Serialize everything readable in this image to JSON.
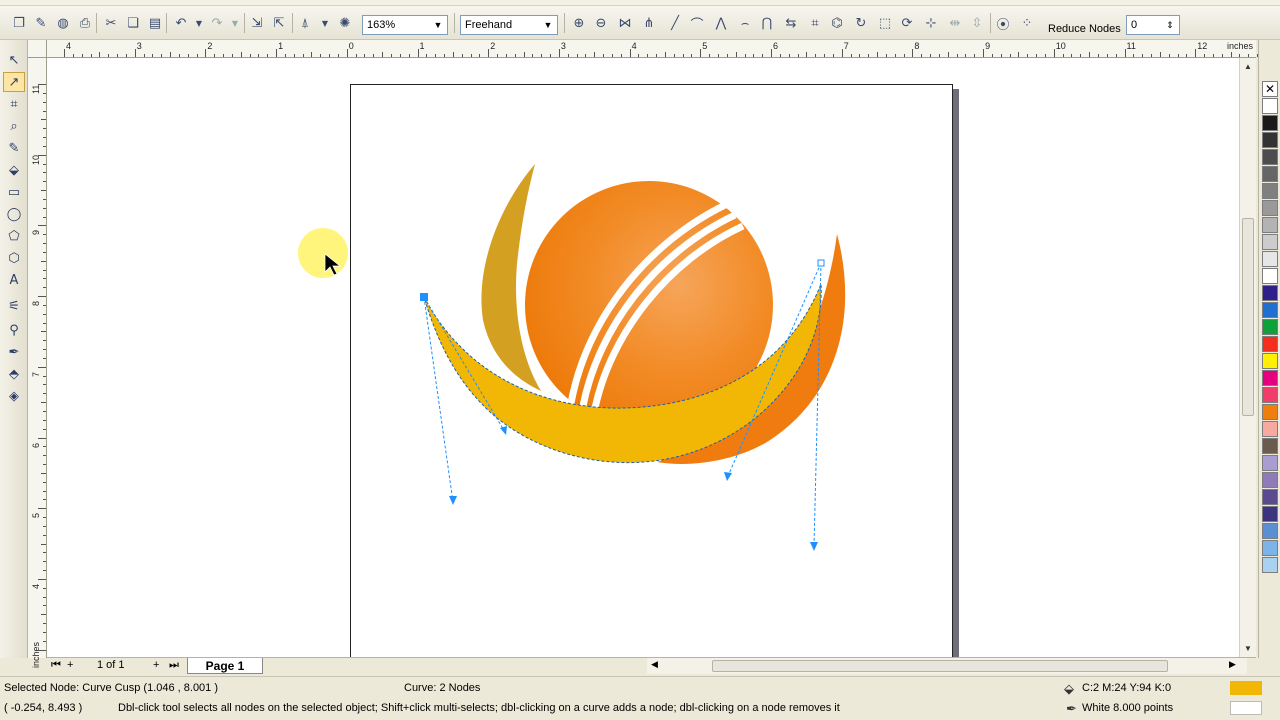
{
  "toolbar": {
    "zoom_value": "163%",
    "freehand_value": "Freehand",
    "reduce_nodes_label": "Reduce Nodes",
    "reduce_nodes_value": "0"
  },
  "ruler": {
    "units": "inches",
    "h_labels": [
      "4",
      "3",
      "2",
      "1",
      "0",
      "1",
      "2",
      "3",
      "4",
      "5",
      "6",
      "7",
      "8",
      "9",
      "10",
      "11",
      "12"
    ],
    "v_labels": [
      "11",
      "10",
      "9",
      "8",
      "7",
      "6",
      "5",
      "4",
      "inches"
    ]
  },
  "page_nav": {
    "page_count": "1 of 1",
    "page_tab": "Page 1"
  },
  "status": {
    "selected_node": "Selected Node: Curve Cusp (1.046 , 8.001 )",
    "curve_info": "Curve: 2 Nodes",
    "cursor_coords": "( -0.254, 8.493 )",
    "hint": "Dbl-click tool selects all nodes on the selected object; Shift+click multi-selects; dbl-clicking on a curve adds a node; dbl-clicking on a node removes it",
    "fill_info": "C:2 M:24 Y:94 K:0",
    "outline_info": "White  8.000 points"
  },
  "colors": {
    "fill": "#f2b705",
    "ball_orange": "#f07c10",
    "swoosh_yellow": "#f2b705",
    "accent_gold": "#d4a021",
    "node_blue": "#1e90ff"
  },
  "palette": [
    "#ffffff",
    "#1a1a1a",
    "#333333",
    "#4d4d4d",
    "#666666",
    "#808080",
    "#999999",
    "#b3b3b3",
    "#cccccc",
    "#e6e6e6",
    "#ffffff",
    "#2e1f8a",
    "#1f6fd1",
    "#0fa03c",
    "#f52d1f",
    "#ffef00",
    "#e6007e",
    "#f03e6a",
    "#f07d10",
    "#f7a8a0",
    "#6b5a4e",
    "#a89cd0",
    "#8e7bb8",
    "#5c4a91",
    "#3c3480",
    "#5a8fd4",
    "#7cb4e8",
    "#a8d2f0"
  ]
}
